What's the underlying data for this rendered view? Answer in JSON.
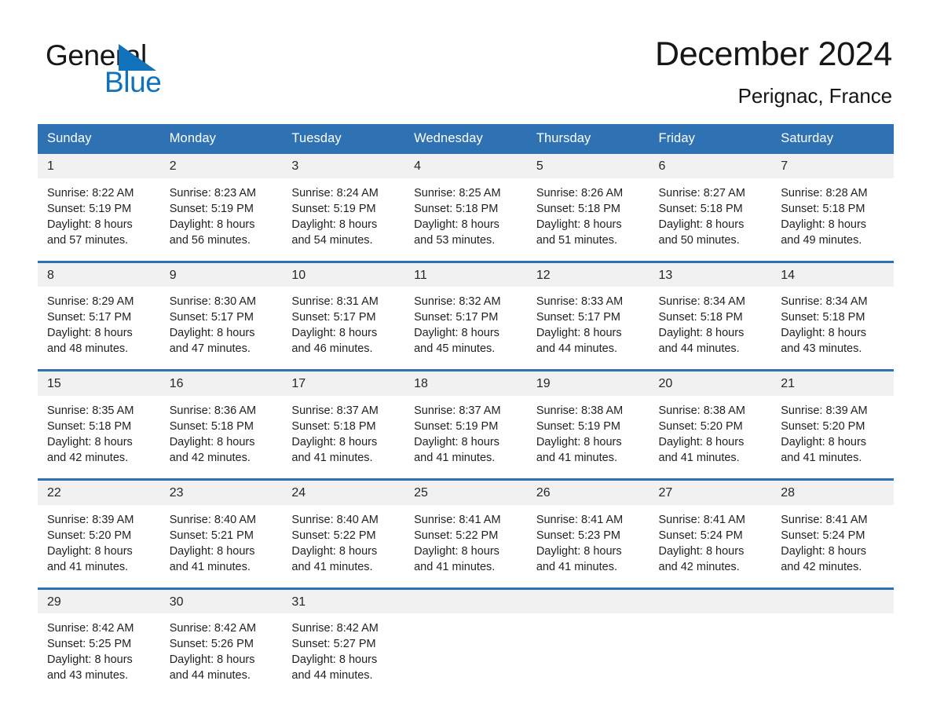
{
  "brand": {
    "name_part1": "General",
    "name_part2": "Blue",
    "triangle_color": "#1072bb",
    "icon": "triangle-logo-icon"
  },
  "header": {
    "month_title": "December 2024",
    "location": "Perignac, France"
  },
  "theme": {
    "header_blue": "#2f72b4",
    "date_band_gray": "#f1f1f1",
    "brand_blue": "#1072bb"
  },
  "calendar": {
    "weekday_headers": [
      "Sunday",
      "Monday",
      "Tuesday",
      "Wednesday",
      "Thursday",
      "Friday",
      "Saturday"
    ],
    "weeks": [
      {
        "dates": [
          "1",
          "2",
          "3",
          "4",
          "5",
          "6",
          "7"
        ],
        "cells": [
          {
            "sunrise": "Sunrise: 8:22 AM",
            "sunset": "Sunset: 5:19 PM",
            "daylight1": "Daylight: 8 hours",
            "daylight2": "and 57 minutes."
          },
          {
            "sunrise": "Sunrise: 8:23 AM",
            "sunset": "Sunset: 5:19 PM",
            "daylight1": "Daylight: 8 hours",
            "daylight2": "and 56 minutes."
          },
          {
            "sunrise": "Sunrise: 8:24 AM",
            "sunset": "Sunset: 5:19 PM",
            "daylight1": "Daylight: 8 hours",
            "daylight2": "and 54 minutes."
          },
          {
            "sunrise": "Sunrise: 8:25 AM",
            "sunset": "Sunset: 5:18 PM",
            "daylight1": "Daylight: 8 hours",
            "daylight2": "and 53 minutes."
          },
          {
            "sunrise": "Sunrise: 8:26 AM",
            "sunset": "Sunset: 5:18 PM",
            "daylight1": "Daylight: 8 hours",
            "daylight2": "and 51 minutes."
          },
          {
            "sunrise": "Sunrise: 8:27 AM",
            "sunset": "Sunset: 5:18 PM",
            "daylight1": "Daylight: 8 hours",
            "daylight2": "and 50 minutes."
          },
          {
            "sunrise": "Sunrise: 8:28 AM",
            "sunset": "Sunset: 5:18 PM",
            "daylight1": "Daylight: 8 hours",
            "daylight2": "and 49 minutes."
          }
        ]
      },
      {
        "dates": [
          "8",
          "9",
          "10",
          "11",
          "12",
          "13",
          "14"
        ],
        "cells": [
          {
            "sunrise": "Sunrise: 8:29 AM",
            "sunset": "Sunset: 5:17 PM",
            "daylight1": "Daylight: 8 hours",
            "daylight2": "and 48 minutes."
          },
          {
            "sunrise": "Sunrise: 8:30 AM",
            "sunset": "Sunset: 5:17 PM",
            "daylight1": "Daylight: 8 hours",
            "daylight2": "and 47 minutes."
          },
          {
            "sunrise": "Sunrise: 8:31 AM",
            "sunset": "Sunset: 5:17 PM",
            "daylight1": "Daylight: 8 hours",
            "daylight2": "and 46 minutes."
          },
          {
            "sunrise": "Sunrise: 8:32 AM",
            "sunset": "Sunset: 5:17 PM",
            "daylight1": "Daylight: 8 hours",
            "daylight2": "and 45 minutes."
          },
          {
            "sunrise": "Sunrise: 8:33 AM",
            "sunset": "Sunset: 5:17 PM",
            "daylight1": "Daylight: 8 hours",
            "daylight2": "and 44 minutes."
          },
          {
            "sunrise": "Sunrise: 8:34 AM",
            "sunset": "Sunset: 5:18 PM",
            "daylight1": "Daylight: 8 hours",
            "daylight2": "and 44 minutes."
          },
          {
            "sunrise": "Sunrise: 8:34 AM",
            "sunset": "Sunset: 5:18 PM",
            "daylight1": "Daylight: 8 hours",
            "daylight2": "and 43 minutes."
          }
        ]
      },
      {
        "dates": [
          "15",
          "16",
          "17",
          "18",
          "19",
          "20",
          "21"
        ],
        "cells": [
          {
            "sunrise": "Sunrise: 8:35 AM",
            "sunset": "Sunset: 5:18 PM",
            "daylight1": "Daylight: 8 hours",
            "daylight2": "and 42 minutes."
          },
          {
            "sunrise": "Sunrise: 8:36 AM",
            "sunset": "Sunset: 5:18 PM",
            "daylight1": "Daylight: 8 hours",
            "daylight2": "and 42 minutes."
          },
          {
            "sunrise": "Sunrise: 8:37 AM",
            "sunset": "Sunset: 5:18 PM",
            "daylight1": "Daylight: 8 hours",
            "daylight2": "and 41 minutes."
          },
          {
            "sunrise": "Sunrise: 8:37 AM",
            "sunset": "Sunset: 5:19 PM",
            "daylight1": "Daylight: 8 hours",
            "daylight2": "and 41 minutes."
          },
          {
            "sunrise": "Sunrise: 8:38 AM",
            "sunset": "Sunset: 5:19 PM",
            "daylight1": "Daylight: 8 hours",
            "daylight2": "and 41 minutes."
          },
          {
            "sunrise": "Sunrise: 8:38 AM",
            "sunset": "Sunset: 5:20 PM",
            "daylight1": "Daylight: 8 hours",
            "daylight2": "and 41 minutes."
          },
          {
            "sunrise": "Sunrise: 8:39 AM",
            "sunset": "Sunset: 5:20 PM",
            "daylight1": "Daylight: 8 hours",
            "daylight2": "and 41 minutes."
          }
        ]
      },
      {
        "dates": [
          "22",
          "23",
          "24",
          "25",
          "26",
          "27",
          "28"
        ],
        "cells": [
          {
            "sunrise": "Sunrise: 8:39 AM",
            "sunset": "Sunset: 5:20 PM",
            "daylight1": "Daylight: 8 hours",
            "daylight2": "and 41 minutes."
          },
          {
            "sunrise": "Sunrise: 8:40 AM",
            "sunset": "Sunset: 5:21 PM",
            "daylight1": "Daylight: 8 hours",
            "daylight2": "and 41 minutes."
          },
          {
            "sunrise": "Sunrise: 8:40 AM",
            "sunset": "Sunset: 5:22 PM",
            "daylight1": "Daylight: 8 hours",
            "daylight2": "and 41 minutes."
          },
          {
            "sunrise": "Sunrise: 8:41 AM",
            "sunset": "Sunset: 5:22 PM",
            "daylight1": "Daylight: 8 hours",
            "daylight2": "and 41 minutes."
          },
          {
            "sunrise": "Sunrise: 8:41 AM",
            "sunset": "Sunset: 5:23 PM",
            "daylight1": "Daylight: 8 hours",
            "daylight2": "and 41 minutes."
          },
          {
            "sunrise": "Sunrise: 8:41 AM",
            "sunset": "Sunset: 5:24 PM",
            "daylight1": "Daylight: 8 hours",
            "daylight2": "and 42 minutes."
          },
          {
            "sunrise": "Sunrise: 8:41 AM",
            "sunset": "Sunset: 5:24 PM",
            "daylight1": "Daylight: 8 hours",
            "daylight2": "and 42 minutes."
          }
        ]
      },
      {
        "dates": [
          "29",
          "30",
          "31",
          "",
          "",
          "",
          ""
        ],
        "cells": [
          {
            "sunrise": "Sunrise: 8:42 AM",
            "sunset": "Sunset: 5:25 PM",
            "daylight1": "Daylight: 8 hours",
            "daylight2": "and 43 minutes."
          },
          {
            "sunrise": "Sunrise: 8:42 AM",
            "sunset": "Sunset: 5:26 PM",
            "daylight1": "Daylight: 8 hours",
            "daylight2": "and 44 minutes."
          },
          {
            "sunrise": "Sunrise: 8:42 AM",
            "sunset": "Sunset: 5:27 PM",
            "daylight1": "Daylight: 8 hours",
            "daylight2": "and 44 minutes."
          },
          {
            "sunrise": "",
            "sunset": "",
            "daylight1": "",
            "daylight2": ""
          },
          {
            "sunrise": "",
            "sunset": "",
            "daylight1": "",
            "daylight2": ""
          },
          {
            "sunrise": "",
            "sunset": "",
            "daylight1": "",
            "daylight2": ""
          },
          {
            "sunrise": "",
            "sunset": "",
            "daylight1": "",
            "daylight2": ""
          }
        ]
      }
    ]
  }
}
